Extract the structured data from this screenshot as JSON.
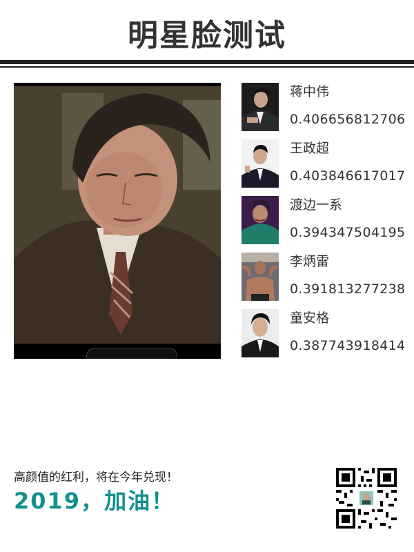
{
  "header": {
    "title": "明星脸测试"
  },
  "matches": [
    {
      "name": "蒋中伟",
      "score": "0.406656812706"
    },
    {
      "name": "王政超",
      "score": "0.403846617017"
    },
    {
      "name": "渡边一系",
      "score": "0.394347504195"
    },
    {
      "name": "李炳雷",
      "score": "0.391813277238"
    },
    {
      "name": "童安格",
      "score": "0.387743918414"
    }
  ],
  "footer": {
    "slogan": "高颜值的红利，将在今年兑现！",
    "cheer": "2019，加油！"
  },
  "colors": {
    "accent": "#138f8f",
    "text": "#333333",
    "rule": "#1f1f1f"
  },
  "icons": {
    "qr": "qr-code-icon"
  }
}
